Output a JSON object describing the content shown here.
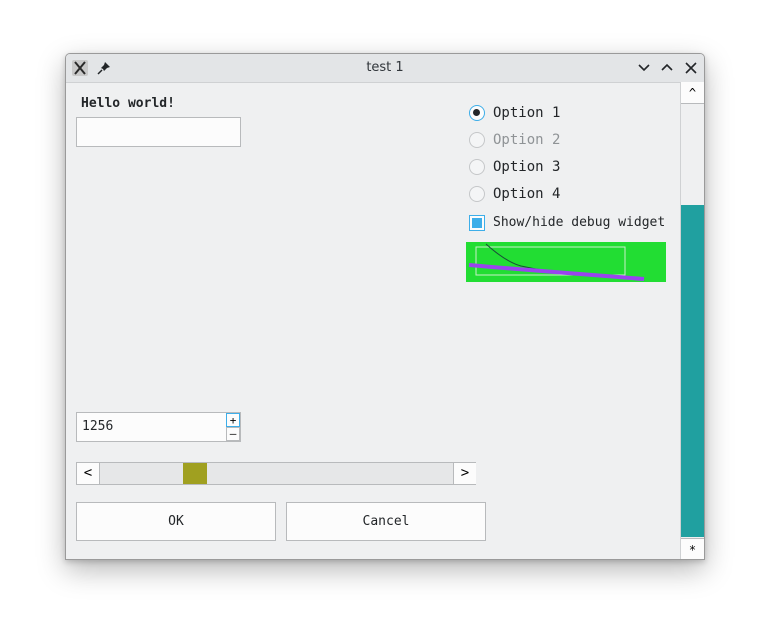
{
  "window": {
    "title": "test 1"
  },
  "form": {
    "greeting": "Hello world!",
    "text_input_value": "",
    "spin_value": "1256",
    "spin_up": "+",
    "spin_down": "–",
    "scroll_prev": "<",
    "scroll_next": ">",
    "ok_label": "OK",
    "cancel_label": "Cancel"
  },
  "options": {
    "items": [
      {
        "label": "Option 1",
        "checked": true,
        "enabled": true
      },
      {
        "label": "Option 2",
        "checked": false,
        "enabled": false
      },
      {
        "label": "Option 3",
        "checked": false,
        "enabled": true
      },
      {
        "label": "Option 4",
        "checked": false,
        "enabled": true
      }
    ],
    "debug_checkbox_label": "Show/hide debug widget"
  },
  "colors": {
    "accent": "#3daee9",
    "scrollbar_fill": "#20a0a0",
    "slider_handle": "#a0a020",
    "debug_bg": "#22dd33",
    "debug_curve": "#9944ee"
  },
  "vertical_scrollbar": {
    "up_glyph": "^",
    "bottom_glyph": "*"
  },
  "horizontal_scroll": {
    "position_fraction": 0.24
  }
}
